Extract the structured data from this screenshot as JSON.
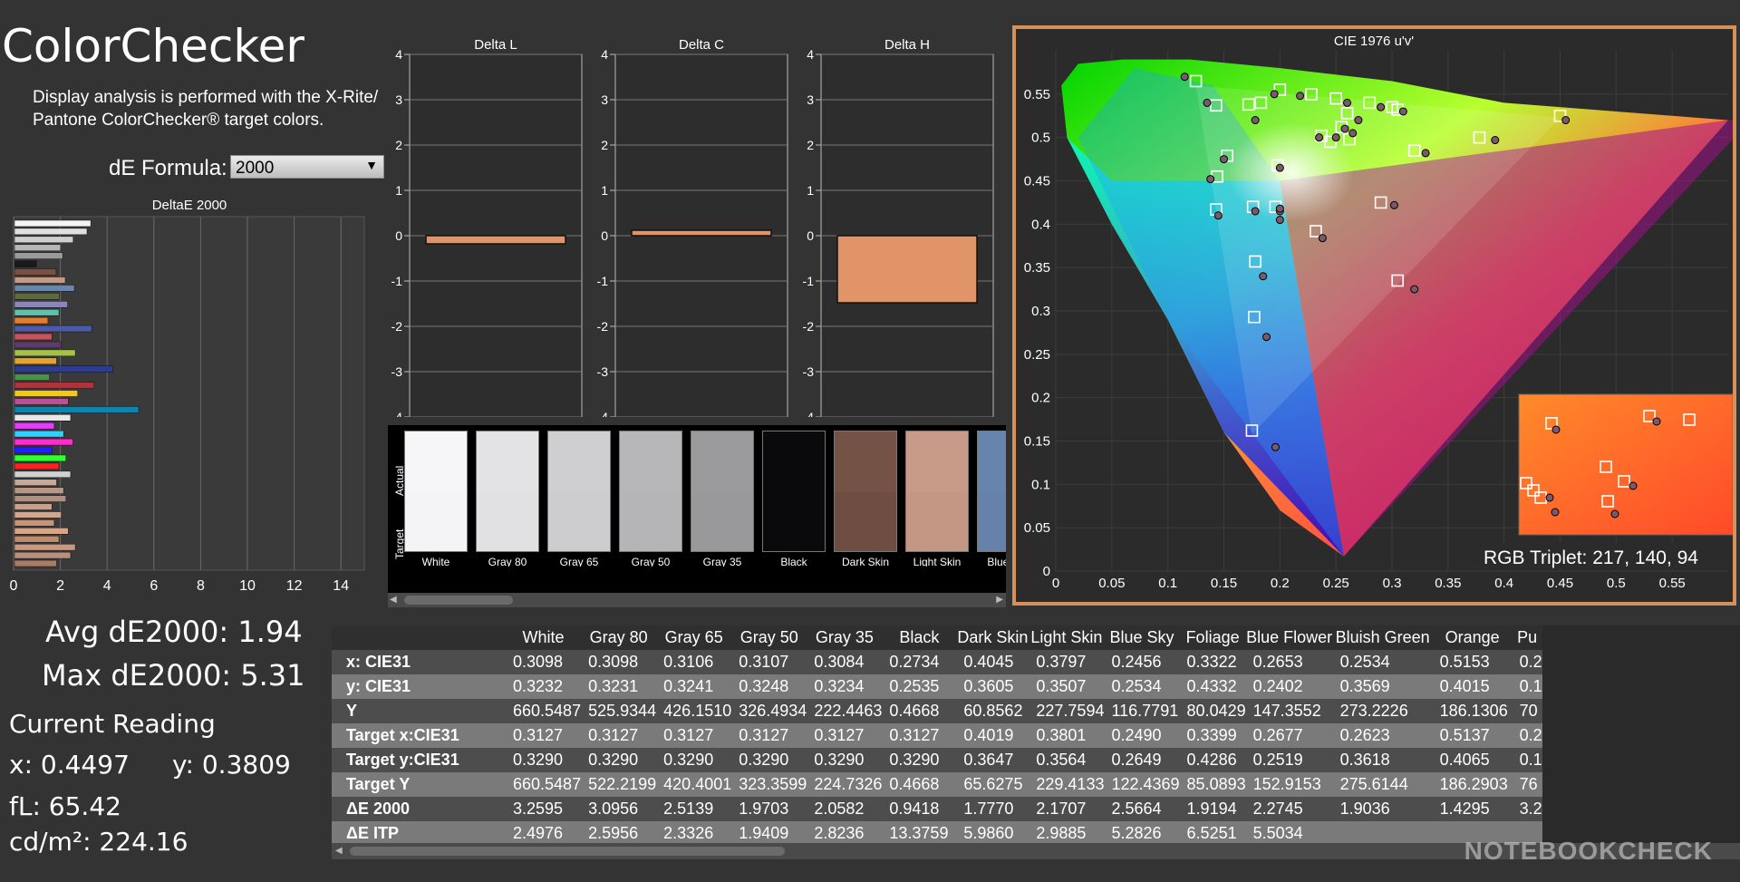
{
  "title": "ColorChecker",
  "description": "Display analysis is performed with the X-Rite/ Pantone ColorChecker® target colors.",
  "formula": {
    "label": "dE Formula:",
    "value": "2000"
  },
  "deltaE_chart": {
    "title": "DeltaE 2000",
    "xticks": [
      "0",
      "2",
      "4",
      "6",
      "8",
      "10",
      "12",
      "14"
    ],
    "xlim": [
      0,
      15
    ],
    "bars": [
      {
        "v": 3.26,
        "c": "#f4f4f4"
      },
      {
        "v": 3.1,
        "c": "#e0e0e0"
      },
      {
        "v": 2.51,
        "c": "#cfcfcf"
      },
      {
        "v": 1.97,
        "c": "#b6b6b6"
      },
      {
        "v": 2.06,
        "c": "#9a9a9a"
      },
      {
        "v": 0.94,
        "c": "#1a1a1a"
      },
      {
        "v": 1.78,
        "c": "#7a5042"
      },
      {
        "v": 2.17,
        "c": "#c59985"
      },
      {
        "v": 2.56,
        "c": "#6a86ad"
      },
      {
        "v": 1.92,
        "c": "#5d6b3a"
      },
      {
        "v": 2.27,
        "c": "#8a86b8"
      },
      {
        "v": 1.9,
        "c": "#5fc2ad"
      },
      {
        "v": 1.43,
        "c": "#e27d2d"
      },
      {
        "v": 3.3,
        "c": "#4c5ba7"
      },
      {
        "v": 1.6,
        "c": "#c7555f"
      },
      {
        "v": 2.0,
        "c": "#5c3c6b"
      },
      {
        "v": 2.6,
        "c": "#a6c04a"
      },
      {
        "v": 1.8,
        "c": "#e6a22e"
      },
      {
        "v": 4.2,
        "c": "#2e3c8f"
      },
      {
        "v": 1.5,
        "c": "#4a9247"
      },
      {
        "v": 3.4,
        "c": "#b0323a"
      },
      {
        "v": 2.7,
        "c": "#f0c81e"
      },
      {
        "v": 2.3,
        "c": "#bb5096"
      },
      {
        "v": 5.31,
        "c": "#0a86b0"
      },
      {
        "v": 2.4,
        "c": "#e8e8e8"
      },
      {
        "v": 1.7,
        "c": "#e43cff"
      },
      {
        "v": 2.1,
        "c": "#30d0ff"
      },
      {
        "v": 2.5,
        "c": "#ff2cd0"
      },
      {
        "v": 1.6,
        "c": "#2020ff"
      },
      {
        "v": 2.2,
        "c": "#30ff30"
      },
      {
        "v": 1.9,
        "c": "#ff2020"
      },
      {
        "v": 2.4,
        "c": "#d0d0d0"
      },
      {
        "v": 1.8,
        "c": "#c8a898"
      },
      {
        "v": 2.1,
        "c": "#b89686"
      },
      {
        "v": 2.2,
        "c": "#b09080"
      },
      {
        "v": 1.6,
        "c": "#c9a08c"
      },
      {
        "v": 2.0,
        "c": "#d2a68e"
      },
      {
        "v": 1.7,
        "c": "#c89478"
      },
      {
        "v": 2.3,
        "c": "#d8a486"
      },
      {
        "v": 1.9,
        "c": "#bf8c70"
      },
      {
        "v": 2.6,
        "c": "#c89880"
      },
      {
        "v": 2.4,
        "c": "#b8907c"
      },
      {
        "v": 1.8,
        "c": "#a87c66"
      }
    ]
  },
  "stats": {
    "avg": "Avg dE2000: 1.94",
    "max": "Max dE2000: 5.31"
  },
  "current": {
    "title": "Current Reading",
    "x": "x: 0.4497",
    "y": "y: 0.3809",
    "fL": "fL: 65.42",
    "cd": "cd/m²: 224.16"
  },
  "delta_charts": [
    {
      "title": "Delta L",
      "value": -0.18
    },
    {
      "title": "Delta C",
      "value": 0.12
    },
    {
      "title": "Delta H",
      "value": -1.48
    }
  ],
  "delta_yticks": [
    "4",
    "3",
    "2",
    "1",
    "0",
    "-1",
    "-2",
    "-3",
    "-4"
  ],
  "swatches": {
    "actual_label": "Actual",
    "target_label": "Target",
    "items": [
      {
        "name": "White",
        "actual": "#f6f6f8",
        "target": "#f4f4f6"
      },
      {
        "name": "Gray 80",
        "actual": "#e3e3e5",
        "target": "#e1e1e3"
      },
      {
        "name": "Gray 65",
        "actual": "#cfcfd1",
        "target": "#cdcdcf"
      },
      {
        "name": "Gray 50",
        "actual": "#b7b7b9",
        "target": "#b5b5b7"
      },
      {
        "name": "Gray 35",
        "actual": "#9b9b9d",
        "target": "#99999b"
      },
      {
        "name": "Black",
        "actual": "#0a0a0c",
        "target": "#0a0a0c"
      },
      {
        "name": "Dark Skin",
        "actual": "#745246",
        "target": "#6e4e42"
      },
      {
        "name": "Light Skin",
        "actual": "#c89b88",
        "target": "#c49684"
      },
      {
        "name": "Blue Sky",
        "actual": "#6684ad",
        "target": "#6682ab"
      }
    ]
  },
  "cie": {
    "title": "CIE 1976 u'v'",
    "xticks": [
      "0",
      "0.05",
      "0.1",
      "0.15",
      "0.2",
      "0.25",
      "0.3",
      "0.35",
      "0.4",
      "0.45",
      "0.5",
      "0.55"
    ],
    "yticks": [
      "0",
      "0.05",
      "0.1",
      "0.15",
      "0.2",
      "0.25",
      "0.3",
      "0.35",
      "0.4",
      "0.45",
      "0.5",
      "0.55"
    ],
    "xlim": [
      0,
      0.6
    ],
    "ylim": [
      0,
      0.6
    ],
    "rgb_triplet": "RGB Triplet: 217, 140, 94"
  },
  "chart_data": {
    "type": "scatter",
    "title": "CIE 1976 u'v'",
    "xlim": [
      0,
      0.6
    ],
    "ylim": [
      0,
      0.6
    ],
    "series": [
      {
        "name": "Target",
        "points": [
          [
            0.45,
            0.525
          ],
          [
            0.378,
            0.5
          ],
          [
            0.32,
            0.485
          ],
          [
            0.29,
            0.425
          ],
          [
            0.232,
            0.392
          ],
          [
            0.305,
            0.335
          ],
          [
            0.178,
            0.357
          ],
          [
            0.177,
            0.293
          ],
          [
            0.175,
            0.162
          ],
          [
            0.143,
            0.417
          ],
          [
            0.176,
            0.42
          ],
          [
            0.196,
            0.42
          ],
          [
            0.144,
            0.455
          ],
          [
            0.153,
            0.479
          ],
          [
            0.143,
            0.537
          ],
          [
            0.125,
            0.565
          ],
          [
            0.183,
            0.54
          ],
          [
            0.2,
            0.555
          ],
          [
            0.228,
            0.55
          ],
          [
            0.25,
            0.545
          ],
          [
            0.26,
            0.528
          ],
          [
            0.28,
            0.54
          ],
          [
            0.3,
            0.535
          ],
          [
            0.305,
            0.532
          ],
          [
            0.237,
            0.502
          ],
          [
            0.245,
            0.495
          ],
          [
            0.255,
            0.512
          ],
          [
            0.262,
            0.498
          ],
          [
            0.198,
            0.468
          ],
          [
            0.172,
            0.538
          ]
        ]
      },
      {
        "name": "Actual",
        "points": [
          [
            0.455,
            0.52
          ],
          [
            0.392,
            0.497
          ],
          [
            0.33,
            0.482
          ],
          [
            0.302,
            0.422
          ],
          [
            0.238,
            0.384
          ],
          [
            0.32,
            0.325
          ],
          [
            0.185,
            0.34
          ],
          [
            0.188,
            0.27
          ],
          [
            0.196,
            0.143
          ],
          [
            0.145,
            0.41
          ],
          [
            0.178,
            0.415
          ],
          [
            0.2,
            0.415
          ],
          [
            0.138,
            0.452
          ],
          [
            0.15,
            0.475
          ],
          [
            0.135,
            0.54
          ],
          [
            0.115,
            0.57
          ],
          [
            0.178,
            0.52
          ],
          [
            0.195,
            0.55
          ],
          [
            0.218,
            0.548
          ],
          [
            0.26,
            0.54
          ],
          [
            0.27,
            0.52
          ],
          [
            0.29,
            0.535
          ],
          [
            0.31,
            0.53
          ],
          [
            0.25,
            0.5
          ],
          [
            0.235,
            0.5
          ],
          [
            0.258,
            0.51
          ],
          [
            0.265,
            0.505
          ],
          [
            0.2,
            0.465
          ],
          [
            0.2,
            0.418
          ],
          [
            0.2,
            0.405
          ]
        ]
      }
    ]
  },
  "table": {
    "columns": [
      "",
      "White",
      "Gray 80",
      "Gray 65",
      "Gray 50",
      "Gray 35",
      "Black",
      "Dark Skin",
      "Light Skin",
      "Blue Sky",
      "Foliage",
      "Blue Flower",
      "Bluish Green",
      "Orange",
      "Pu"
    ],
    "rows": [
      [
        "x: CIE31",
        "0.3098",
        "0.3098",
        "0.3106",
        "0.3107",
        "0.3084",
        "0.2734",
        "0.4045",
        "0.3797",
        "0.2456",
        "0.3322",
        "0.2653",
        "0.2534",
        "0.5153",
        "0.2"
      ],
      [
        "y: CIE31",
        "0.3232",
        "0.3231",
        "0.3241",
        "0.3248",
        "0.3234",
        "0.2535",
        "0.3605",
        "0.3507",
        "0.2534",
        "0.4332",
        "0.2402",
        "0.3569",
        "0.4015",
        "0.1"
      ],
      [
        "Y",
        "660.5487",
        "525.9344",
        "426.1510",
        "326.4934",
        "222.4463",
        "0.4668",
        "60.8562",
        "227.7594",
        "116.7791",
        "80.0429",
        "147.3552",
        "273.2226",
        "186.1306",
        "70"
      ],
      [
        "Target x:CIE31",
        "0.3127",
        "0.3127",
        "0.3127",
        "0.3127",
        "0.3127",
        "0.3127",
        "0.4019",
        "0.3801",
        "0.2490",
        "0.3399",
        "0.2677",
        "0.2623",
        "0.5137",
        "0.2"
      ],
      [
        "Target y:CIE31",
        "0.3290",
        "0.3290",
        "0.3290",
        "0.3290",
        "0.3290",
        "0.3290",
        "0.3647",
        "0.3564",
        "0.2649",
        "0.4286",
        "0.2519",
        "0.3618",
        "0.4065",
        "0.1"
      ],
      [
        "Target Y",
        "660.5487",
        "522.2199",
        "420.4001",
        "323.3599",
        "224.7326",
        "0.4668",
        "65.6275",
        "229.4133",
        "122.4369",
        "85.0893",
        "152.9153",
        "275.6144",
        "186.2903",
        "76"
      ],
      [
        "ΔE 2000",
        "3.2595",
        "3.0956",
        "2.5139",
        "1.9703",
        "2.0582",
        "0.9418",
        "1.7770",
        "2.1707",
        "2.5664",
        "1.9194",
        "2.2745",
        "1.9036",
        "1.4295",
        "3.2"
      ],
      [
        "ΔE ITP",
        "2.4976",
        "2.5956",
        "2.3326",
        "1.9409",
        "2.8236",
        "13.3759",
        "5.9860",
        "2.9885",
        "5.2826",
        "6.5251",
        "5.5034",
        "",
        "",
        ""
      ]
    ]
  },
  "watermark": "NOTEBOOKCHECK"
}
